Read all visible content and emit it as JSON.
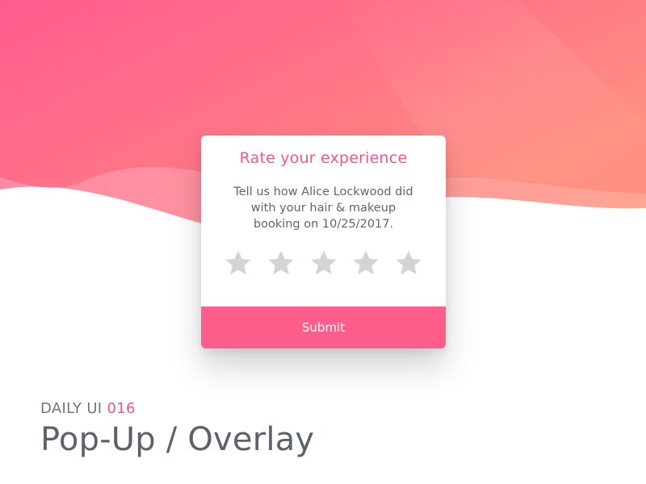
{
  "colors": {
    "background_gradient_start": "#ff5f8f",
    "background_gradient_end": "#ff8d7e",
    "title": "#f0588a",
    "text": "#5f6570",
    "star_empty": "#d4d4d4",
    "submit_bg": "#ff5d8c",
    "caption_accent": "#ef5588"
  },
  "popup": {
    "title": "Rate your experience",
    "description": "Tell us how Alice Lockwood did with your hair & makeup booking on 10/25/2017.",
    "rating": {
      "value": 0,
      "max": 5
    },
    "stars": [
      {
        "icon": "star-empty"
      },
      {
        "icon": "star-empty"
      },
      {
        "icon": "star-empty"
      },
      {
        "icon": "star-empty"
      },
      {
        "icon": "star-empty"
      }
    ],
    "submit_label": "Submit"
  },
  "caption": {
    "series": "DAILY UI",
    "number": "016",
    "title": "Pop-Up / Overlay"
  }
}
